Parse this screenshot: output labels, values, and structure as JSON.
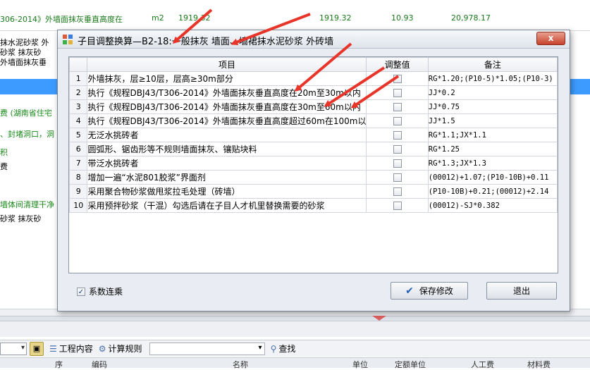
{
  "background": {
    "top_row": {
      "item_text": "306-2014》外墙面抹灰垂直高度在",
      "unit": "m2",
      "qty": "1919.32",
      "qty2": "1919.32",
      "price": "10.93",
      "total": "20,978.17"
    },
    "left_lines": [
      {
        "text": "抹水泥砂浆 外",
        "green": false
      },
      {
        "text": "砂浆 抹灰砂",
        "green": false
      },
      {
        "text": "外墙面抹灰垂",
        "green": false
      },
      {
        "text": "费 (湖南省住宅",
        "green": true
      },
      {
        "text": "、封堵洞口，洞",
        "green": true
      },
      {
        "text": "积",
        "green": true
      },
      {
        "text": "费",
        "green": false
      },
      {
        "text": "墙体间清理干净",
        "green": true
      },
      {
        "text": "砂浆 抹灰砂",
        "green": false
      }
    ],
    "toolbar": {
      "project_content": "工程内容",
      "calc_rules": "计算规则",
      "find": "查找"
    },
    "header_cols": {
      "seq": "序",
      "code": "编码",
      "name": "名称",
      "unit": "单位",
      "quota_unit": "定额单位",
      "labor": "人工费",
      "material": "材料费"
    }
  },
  "dialog": {
    "title": "子目调整换算—B2-18:一般抹灰 墙面、墙裙抹水泥砂浆 外砖墙",
    "columns": {
      "item": "项目",
      "adjust": "调整值",
      "note": "备注"
    },
    "rows": [
      {
        "no": "1",
        "item": "外墙抹灰，层≥10层，层高≥30m部分",
        "checked": false,
        "note": "RG*1.20;(P10-5)*1.05;(P10-3)"
      },
      {
        "no": "2",
        "item": "执行《规程DBJ43/T306-2014》外墙面抹灰垂直高度在20m至30m以内",
        "checked": false,
        "note": "JJ*0.2"
      },
      {
        "no": "3",
        "item": "执行《规程DBJ43/T306-2014》外墙面抹灰垂直高度在30m至60m以内",
        "checked": false,
        "note": "JJ*0.75"
      },
      {
        "no": "4",
        "item": "执行《规程DBJ43/T306-2014》外墙面抹灰垂直高度超过60m在100m以",
        "checked": false,
        "note": "JJ*1.5"
      },
      {
        "no": "5",
        "item": "无泛水挑砖者",
        "checked": false,
        "note": "RG*1.1;JX*1.1"
      },
      {
        "no": "6",
        "item": "圆弧形、锯齿形等不规则墙面抹灰、镶贴块料",
        "checked": false,
        "note": "RG*1.25"
      },
      {
        "no": "7",
        "item": "带泛水挑砖者",
        "checked": false,
        "note": "RG*1.3;JX*1.3"
      },
      {
        "no": "8",
        "item": "增加一遍“水泥801胶浆”界面剂",
        "checked": false,
        "note": "(00012)+1.07;(P10-10B)+0.11"
      },
      {
        "no": "9",
        "item": "采用聚合物砂浆做甩浆拉毛处理（砖墙）",
        "checked": false,
        "note": "(P10-10B)+0.21;(00012)+2.14"
      },
      {
        "no": "10",
        "item": "采用预拌砂浆（干混）勾选后请在子目人才机里替换需要的砂浆",
        "checked": false,
        "note": "(00012)-SJ*0.382"
      }
    ],
    "coefficient_label": "系数连乘",
    "coefficient_checked": true,
    "save_label": "保存修改",
    "exit_label": "退出",
    "close_label": "x"
  },
  "colors": {
    "accent_blue": "#3d9bff",
    "arrow_red": "#e8352a",
    "green_text": "#1a7a1a"
  }
}
